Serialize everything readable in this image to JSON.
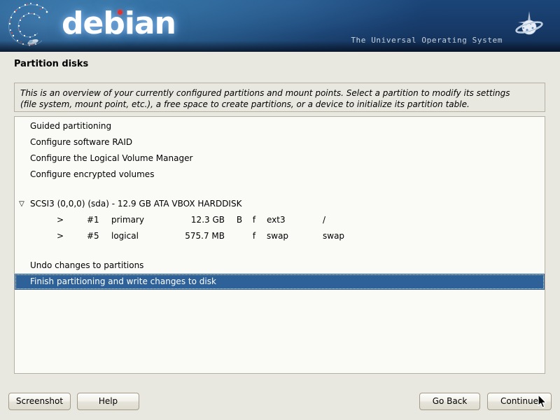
{
  "banner": {
    "wordmark": "debian",
    "tagline": "The Universal Operating System",
    "logo_icon": "debian-swirl-icon",
    "planet_icon": "saturn-planet-icon",
    "bg_color": "#0d2342",
    "wordmark_color": "#ffffff",
    "accent_dot_color": "#e03030"
  },
  "page": {
    "title": "Partition disks",
    "description_line1": "This is an overview of your currently configured partitions and mount points. Select a partition to modify its settings",
    "description_line2": "(file system, mount point, etc.), a free space to create partitions, or a device to initialize its partition table.",
    "background_color": "#e8e8e0",
    "panel_background": "#fafaf7",
    "panel_border": "#b5b0a1",
    "selection_color": "#2f6199"
  },
  "list": {
    "actions_top": [
      {
        "label": "Guided partitioning"
      },
      {
        "label": "Configure software RAID"
      },
      {
        "label": "Configure the Logical Volume Manager"
      },
      {
        "label": "Configure encrypted volumes"
      }
    ],
    "device": {
      "twisty": "▽",
      "label": "SCSI3 (0,0,0) (sda) - 12.9 GB ATA VBOX HARDDISK"
    },
    "partitions": [
      {
        "marker": ">",
        "number": "#1",
        "type": "primary",
        "size": "12.3 GB",
        "flag_boot": "B",
        "flag_format": "f",
        "filesystem": "ext3",
        "mountpoint": "/"
      },
      {
        "marker": ">",
        "number": "#5",
        "type": "logical",
        "size": "575.7 MB",
        "flag_boot": "",
        "flag_format": "f",
        "filesystem": "swap",
        "mountpoint": "swap"
      }
    ],
    "actions_bottom": [
      {
        "label": "Undo changes to partitions",
        "selected": false
      },
      {
        "label": "Finish partitioning and write changes to disk",
        "selected": true
      }
    ]
  },
  "buttons": {
    "screenshot": "Screenshot",
    "help": "Help",
    "go_back": "Go Back",
    "continue": "Continue"
  },
  "cursor": {
    "icon": "mouse-pointer-icon"
  }
}
